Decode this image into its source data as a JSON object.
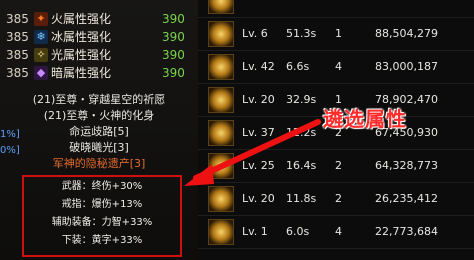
{
  "elements": [
    {
      "num": "385",
      "icon": "fire-icon",
      "label": "火属性强化",
      "value": "390"
    },
    {
      "num": "385",
      "icon": "ice-icon",
      "label": "冰属性强化",
      "value": "390"
    },
    {
      "num": "385",
      "icon": "light-icon",
      "label": "光属性强化",
      "value": "390"
    },
    {
      "num": "385",
      "icon": "dark-icon",
      "label": "暗属性强化",
      "value": "390"
    }
  ],
  "titles": {
    "t1": "(21)至尊・穿越星空的祈愿",
    "t2": "(21)至尊・火神的化身",
    "t3": "命运歧路[5]",
    "t4": "破晓曦光[3]",
    "t5": "军神的隐秘遗产[3]",
    "edge1": "1%]",
    "edge2": "0%]"
  },
  "highlight": {
    "l1": "武器：终伤+30%",
    "l2": "戒指：爆伤+13%",
    "l3": "辅助装备：力智+33%",
    "l4": "下装：黄字+33%"
  },
  "skills": [
    {
      "lv": "Lv. 6",
      "cd": "51.3s",
      "n": "1",
      "dmg": "88,504,279"
    },
    {
      "lv": "Lv. 42",
      "cd": "6.6s",
      "n": "4",
      "dmg": "83,000,187"
    },
    {
      "lv": "Lv. 20",
      "cd": "32.9s",
      "n": "1",
      "dmg": "78,902,470"
    },
    {
      "lv": "Lv. 37",
      "cd": "12.2s",
      "n": "2",
      "dmg": "67,450,930"
    },
    {
      "lv": "Lv. 25",
      "cd": "16.4s",
      "n": "2",
      "dmg": "64,328,773"
    },
    {
      "lv": "Lv. 20",
      "cd": "11.8s",
      "n": "2",
      "dmg": "26,235,412"
    },
    {
      "lv": "Lv. 1",
      "cd": "6.0s",
      "n": "4",
      "dmg": "22,773,684"
    }
  ],
  "annotation": "遴选属性",
  "colors": {
    "accent_red": "#d01010",
    "green_value": "#79d54a",
    "orange_title": "#e26a2c"
  }
}
